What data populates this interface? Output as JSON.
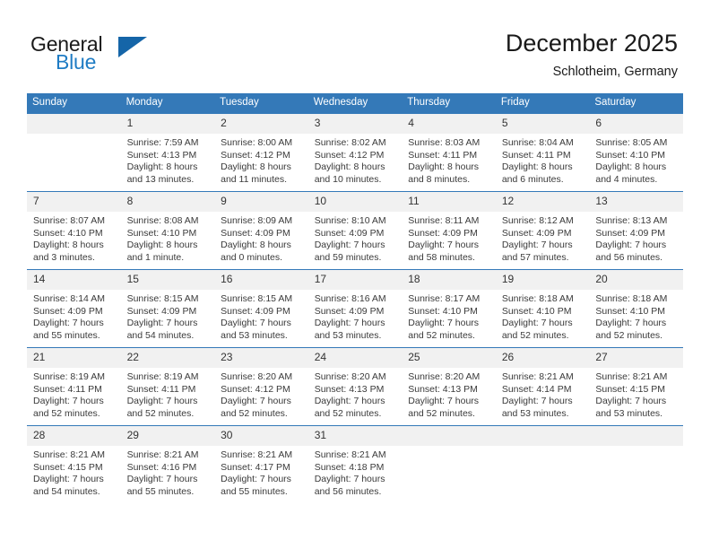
{
  "brand": {
    "name_part1": "General",
    "name_part2": "Blue",
    "logo_icon": "blue-triangle-logo",
    "accent_color": "#1565a8",
    "text_color": "#1f7cc4"
  },
  "header": {
    "title": "December 2025",
    "subtitle": "Schlotheim, Germany"
  },
  "theme": {
    "header_row_color": "#3479b8",
    "daynum_band_color": "#f1f1f1",
    "separator_color": "#3479b8"
  },
  "weekday_headers": [
    "Sunday",
    "Monday",
    "Tuesday",
    "Wednesday",
    "Thursday",
    "Friday",
    "Saturday"
  ],
  "weeks": [
    [
      {
        "day": "",
        "empty": true,
        "sunrise": "",
        "sunset": "",
        "daylight1": "",
        "daylight2": ""
      },
      {
        "day": "1",
        "sunrise": "Sunrise: 7:59 AM",
        "sunset": "Sunset: 4:13 PM",
        "daylight1": "Daylight: 8 hours",
        "daylight2": "and 13 minutes."
      },
      {
        "day": "2",
        "sunrise": "Sunrise: 8:00 AM",
        "sunset": "Sunset: 4:12 PM",
        "daylight1": "Daylight: 8 hours",
        "daylight2": "and 11 minutes."
      },
      {
        "day": "3",
        "sunrise": "Sunrise: 8:02 AM",
        "sunset": "Sunset: 4:12 PM",
        "daylight1": "Daylight: 8 hours",
        "daylight2": "and 10 minutes."
      },
      {
        "day": "4",
        "sunrise": "Sunrise: 8:03 AM",
        "sunset": "Sunset: 4:11 PM",
        "daylight1": "Daylight: 8 hours",
        "daylight2": "and 8 minutes."
      },
      {
        "day": "5",
        "sunrise": "Sunrise: 8:04 AM",
        "sunset": "Sunset: 4:11 PM",
        "daylight1": "Daylight: 8 hours",
        "daylight2": "and 6 minutes."
      },
      {
        "day": "6",
        "sunrise": "Sunrise: 8:05 AM",
        "sunset": "Sunset: 4:10 PM",
        "daylight1": "Daylight: 8 hours",
        "daylight2": "and 4 minutes."
      }
    ],
    [
      {
        "day": "7",
        "sunrise": "Sunrise: 8:07 AM",
        "sunset": "Sunset: 4:10 PM",
        "daylight1": "Daylight: 8 hours",
        "daylight2": "and 3 minutes."
      },
      {
        "day": "8",
        "sunrise": "Sunrise: 8:08 AM",
        "sunset": "Sunset: 4:10 PM",
        "daylight1": "Daylight: 8 hours",
        "daylight2": "and 1 minute."
      },
      {
        "day": "9",
        "sunrise": "Sunrise: 8:09 AM",
        "sunset": "Sunset: 4:09 PM",
        "daylight1": "Daylight: 8 hours",
        "daylight2": "and 0 minutes."
      },
      {
        "day": "10",
        "sunrise": "Sunrise: 8:10 AM",
        "sunset": "Sunset: 4:09 PM",
        "daylight1": "Daylight: 7 hours",
        "daylight2": "and 59 minutes."
      },
      {
        "day": "11",
        "sunrise": "Sunrise: 8:11 AM",
        "sunset": "Sunset: 4:09 PM",
        "daylight1": "Daylight: 7 hours",
        "daylight2": "and 58 minutes."
      },
      {
        "day": "12",
        "sunrise": "Sunrise: 8:12 AM",
        "sunset": "Sunset: 4:09 PM",
        "daylight1": "Daylight: 7 hours",
        "daylight2": "and 57 minutes."
      },
      {
        "day": "13",
        "sunrise": "Sunrise: 8:13 AM",
        "sunset": "Sunset: 4:09 PM",
        "daylight1": "Daylight: 7 hours",
        "daylight2": "and 56 minutes."
      }
    ],
    [
      {
        "day": "14",
        "sunrise": "Sunrise: 8:14 AM",
        "sunset": "Sunset: 4:09 PM",
        "daylight1": "Daylight: 7 hours",
        "daylight2": "and 55 minutes."
      },
      {
        "day": "15",
        "sunrise": "Sunrise: 8:15 AM",
        "sunset": "Sunset: 4:09 PM",
        "daylight1": "Daylight: 7 hours",
        "daylight2": "and 54 minutes."
      },
      {
        "day": "16",
        "sunrise": "Sunrise: 8:15 AM",
        "sunset": "Sunset: 4:09 PM",
        "daylight1": "Daylight: 7 hours",
        "daylight2": "and 53 minutes."
      },
      {
        "day": "17",
        "sunrise": "Sunrise: 8:16 AM",
        "sunset": "Sunset: 4:09 PM",
        "daylight1": "Daylight: 7 hours",
        "daylight2": "and 53 minutes."
      },
      {
        "day": "18",
        "sunrise": "Sunrise: 8:17 AM",
        "sunset": "Sunset: 4:10 PM",
        "daylight1": "Daylight: 7 hours",
        "daylight2": "and 52 minutes."
      },
      {
        "day": "19",
        "sunrise": "Sunrise: 8:18 AM",
        "sunset": "Sunset: 4:10 PM",
        "daylight1": "Daylight: 7 hours",
        "daylight2": "and 52 minutes."
      },
      {
        "day": "20",
        "sunrise": "Sunrise: 8:18 AM",
        "sunset": "Sunset: 4:10 PM",
        "daylight1": "Daylight: 7 hours",
        "daylight2": "and 52 minutes."
      }
    ],
    [
      {
        "day": "21",
        "sunrise": "Sunrise: 8:19 AM",
        "sunset": "Sunset: 4:11 PM",
        "daylight1": "Daylight: 7 hours",
        "daylight2": "and 52 minutes."
      },
      {
        "day": "22",
        "sunrise": "Sunrise: 8:19 AM",
        "sunset": "Sunset: 4:11 PM",
        "daylight1": "Daylight: 7 hours",
        "daylight2": "and 52 minutes."
      },
      {
        "day": "23",
        "sunrise": "Sunrise: 8:20 AM",
        "sunset": "Sunset: 4:12 PM",
        "daylight1": "Daylight: 7 hours",
        "daylight2": "and 52 minutes."
      },
      {
        "day": "24",
        "sunrise": "Sunrise: 8:20 AM",
        "sunset": "Sunset: 4:13 PM",
        "daylight1": "Daylight: 7 hours",
        "daylight2": "and 52 minutes."
      },
      {
        "day": "25",
        "sunrise": "Sunrise: 8:20 AM",
        "sunset": "Sunset: 4:13 PM",
        "daylight1": "Daylight: 7 hours",
        "daylight2": "and 52 minutes."
      },
      {
        "day": "26",
        "sunrise": "Sunrise: 8:21 AM",
        "sunset": "Sunset: 4:14 PM",
        "daylight1": "Daylight: 7 hours",
        "daylight2": "and 53 minutes."
      },
      {
        "day": "27",
        "sunrise": "Sunrise: 8:21 AM",
        "sunset": "Sunset: 4:15 PM",
        "daylight1": "Daylight: 7 hours",
        "daylight2": "and 53 minutes."
      }
    ],
    [
      {
        "day": "28",
        "sunrise": "Sunrise: 8:21 AM",
        "sunset": "Sunset: 4:15 PM",
        "daylight1": "Daylight: 7 hours",
        "daylight2": "and 54 minutes."
      },
      {
        "day": "29",
        "sunrise": "Sunrise: 8:21 AM",
        "sunset": "Sunset: 4:16 PM",
        "daylight1": "Daylight: 7 hours",
        "daylight2": "and 55 minutes."
      },
      {
        "day": "30",
        "sunrise": "Sunrise: 8:21 AM",
        "sunset": "Sunset: 4:17 PM",
        "daylight1": "Daylight: 7 hours",
        "daylight2": "and 55 minutes."
      },
      {
        "day": "31",
        "sunrise": "Sunrise: 8:21 AM",
        "sunset": "Sunset: 4:18 PM",
        "daylight1": "Daylight: 7 hours",
        "daylight2": "and 56 minutes."
      },
      {
        "day": "",
        "empty": true,
        "sunrise": "",
        "sunset": "",
        "daylight1": "",
        "daylight2": ""
      },
      {
        "day": "",
        "empty": true,
        "sunrise": "",
        "sunset": "",
        "daylight1": "",
        "daylight2": ""
      },
      {
        "day": "",
        "empty": true,
        "sunrise": "",
        "sunset": "",
        "daylight1": "",
        "daylight2": ""
      }
    ]
  ]
}
